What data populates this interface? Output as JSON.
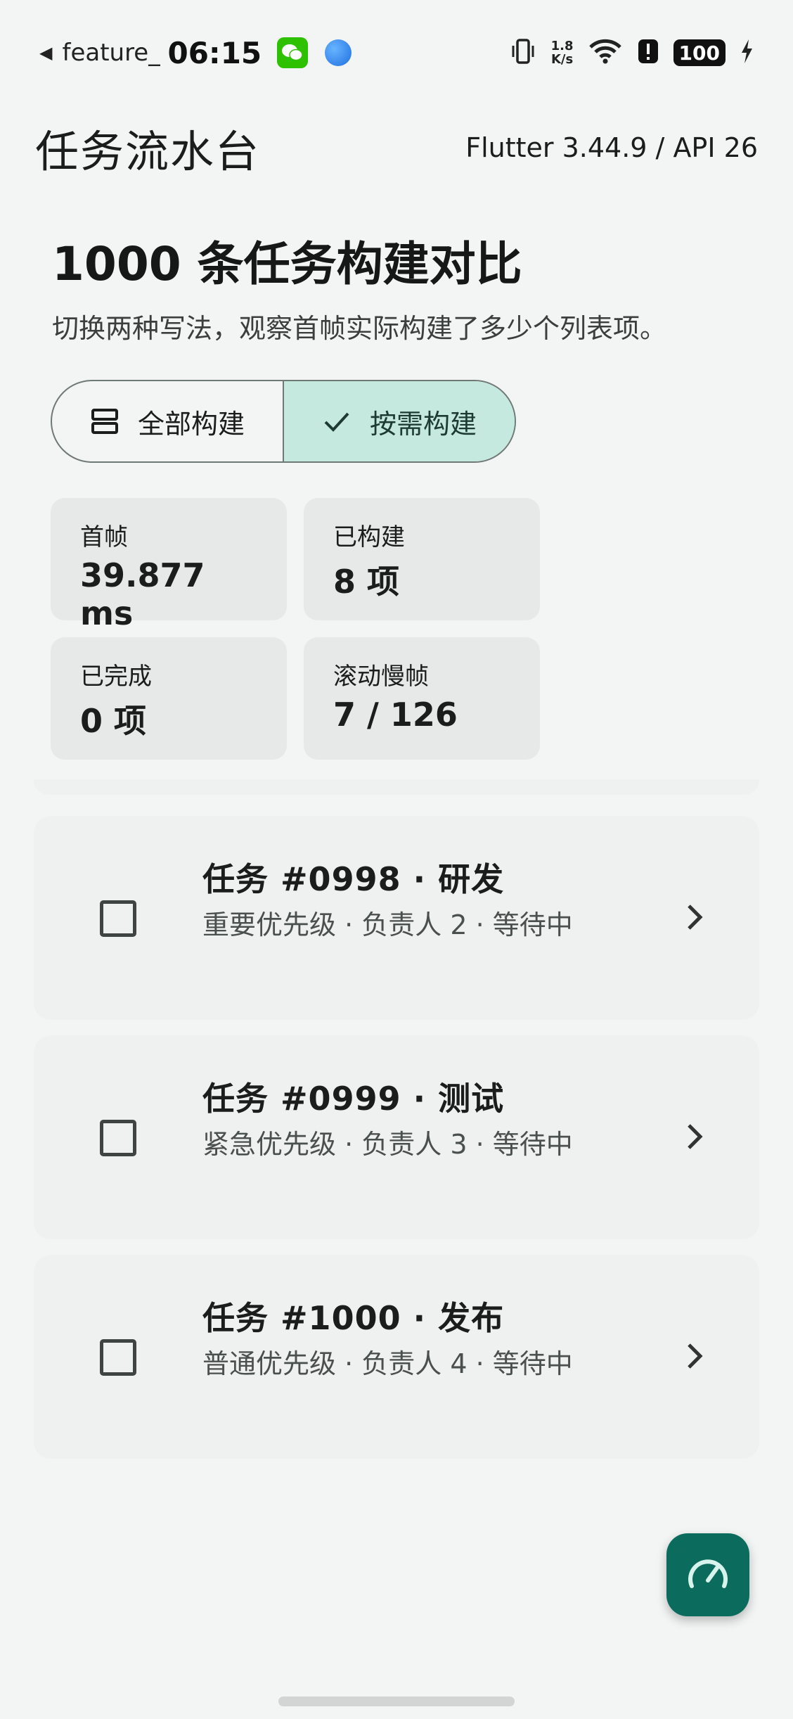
{
  "status_bar": {
    "feature_text": "feature_",
    "time": "06:15",
    "net_speed_value": "1.8",
    "net_speed_unit": "K/s",
    "battery": "100"
  },
  "app_bar": {
    "title": "任务流水台",
    "subtitle": "Flutter 3.44.9 / API 26"
  },
  "header": {
    "title": "1000 条任务构建对比",
    "description": "切换两种写法，观察首帧实际构建了多少个列表项。"
  },
  "toggle": {
    "options": [
      {
        "label": "全部构建",
        "icon": "list-icon",
        "selected": false
      },
      {
        "label": "按需构建",
        "icon": "check-icon",
        "selected": true
      }
    ]
  },
  "stats": [
    {
      "label": "首帧",
      "value": "39.877 ms"
    },
    {
      "label": "已构建",
      "value": "8 项"
    },
    {
      "label": "已完成",
      "value": "0 项"
    },
    {
      "label": "滚动慢帧",
      "value": "7 / 126"
    }
  ],
  "tasks": [
    {
      "title": "任务 #0998 · 研发",
      "subtitle": "重要优先级 · 负责人 2 · 等待中",
      "checked": false
    },
    {
      "title": "任务 #0999 · 测试",
      "subtitle": "紧急优先级 · 负责人 3 · 等待中",
      "checked": false
    },
    {
      "title": "任务 #1000 · 发布",
      "subtitle": "普通优先级 · 负责人 4 · 等待中",
      "checked": false
    }
  ],
  "fab": {
    "icon": "speedometer-icon"
  },
  "colors": {
    "background": "#f3f5f4",
    "accent": "#0b6c5e",
    "selected_segment": "#c5e8df",
    "card": "#e6e9e8"
  }
}
